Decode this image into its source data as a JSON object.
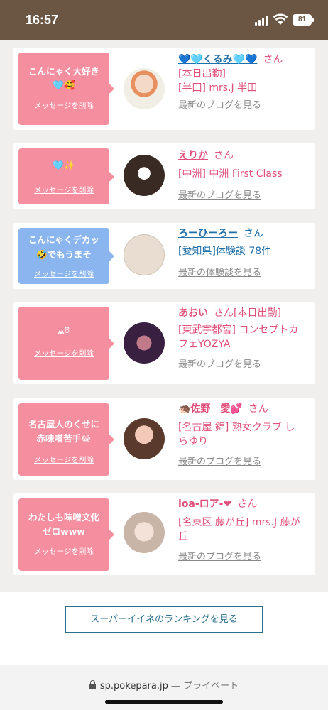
{
  "status": {
    "time": "16:57",
    "battery": "81"
  },
  "messages": [
    {
      "bubble_text_line1": "こんにゃく大好き",
      "bubble_text_line2": "🩵🥰",
      "bubble_color": "#f58fa0",
      "delete_label": "メッセージを削除",
      "name": "💙🩵くるみ🩵💙",
      "honorific": "さん",
      "name_suffix": "",
      "status_line": "[本日出勤]",
      "shop_line1": "[半田] mrs.J 半田",
      "shop_line2": "",
      "blog_link": "最新のブログを見る"
    },
    {
      "bubble_text_line1": "🩵✨",
      "bubble_text_line2": "",
      "bubble_color": "#f58fa0",
      "delete_label": "メッセージを削除",
      "name": "えりか",
      "honorific": "さん",
      "name_suffix": "",
      "status_line": "",
      "shop_line1": "[中洲] 中洲 First Class",
      "shop_line2": "",
      "blog_link": "最新のブログを見る"
    },
    {
      "bubble_text_line1": "こんにゃくデカッ",
      "bubble_text_line2": "🤣でもうまそ",
      "bubble_color": "#8ab5ee",
      "delete_label": "メッセージを削除",
      "name": "ろーひーろー",
      "honorific": "さん",
      "name_suffix": "",
      "status_line": "",
      "shop_line1": "[愛知県]体験談 78件",
      "shop_line2": "",
      "blog_link": "最新の体験談を見る"
    },
    {
      "bubble_text_line1": "៳៝",
      "bubble_text_line2": "",
      "bubble_color": "#f58fa0",
      "delete_label": "メッセージを削除",
      "name": "あおい",
      "honorific": "さん",
      "name_suffix": "[本日出勤]",
      "status_line": "",
      "shop_line1": "[東武宇都宮] コンセプトカ",
      "shop_line2": "フェYOZYA",
      "blog_link": "最新のブログを見る"
    },
    {
      "bubble_text_line1": "名古屋人のくせに",
      "bubble_text_line2": "赤味噌苦手😂",
      "bubble_color": "#f58fa0",
      "delete_label": "メッセージを削除",
      "name": "🦔佐野　愛💕",
      "honorific": "さん",
      "name_suffix": "",
      "status_line": "",
      "shop_line1": "[名古屋 錦] 熟女クラブ し",
      "shop_line2": "らゆり",
      "blog_link": "最新のブログを見る"
    },
    {
      "bubble_text_line1": "わたしも味噌文化",
      "bubble_text_line2": "ゼロwww",
      "bubble_color": "#f58fa0",
      "delete_label": "メッセージを削除",
      "name": "loa-ロア-❤",
      "honorific": "さん",
      "name_suffix": "",
      "status_line": "",
      "shop_line1": "[名東区 藤が丘] mrs.J 藤が",
      "shop_line2": "丘",
      "blog_link": "最新のブログを見る"
    }
  ],
  "ranking_button": "スーパーイイネのランキングを見る",
  "url_bar": {
    "domain": "sp.pokepara.jp",
    "privacy": " — プライベート"
  },
  "colors": {
    "accent_pink": "#e0507a",
    "accent_blue": "#1f6fa8",
    "status_bar": "#6b5644"
  }
}
